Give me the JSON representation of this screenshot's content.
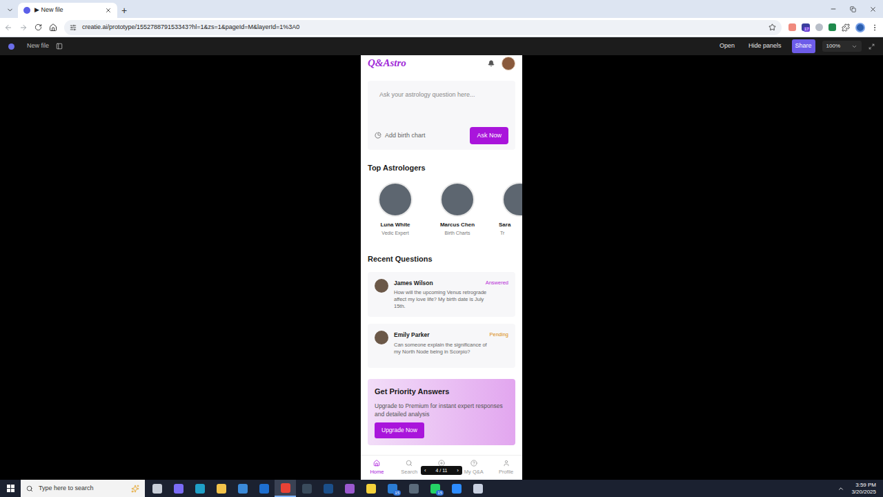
{
  "browser": {
    "tabs": [
      {
        "label": "▶ New file",
        "selected": true
      }
    ],
    "new_tab": "+",
    "url": "creatie.ai/prototype/155278879153343?hl=1&zs=1&pageId=M&layerId=1%3A0",
    "extension_badge": "17"
  },
  "toolbar": {
    "file_name": "New file",
    "buttons": [
      {
        "label": "Open",
        "kind": "plain"
      },
      {
        "label": "Hide panels",
        "kind": "plain"
      },
      {
        "label": "Share",
        "kind": "primary"
      }
    ],
    "zoom": "100%"
  },
  "app": {
    "logo": "Q&Astro",
    "question_placeholder": "Ask your astrology question here...",
    "birth_chart": "Add birth chart",
    "ask_button": "Ask Now",
    "astrologers_title": "Top Astrologers",
    "astrologers": [
      {
        "name": "Luna White",
        "specialty": "Vedic Expert",
        "clipped": false
      },
      {
        "name": "Marcus Chen",
        "specialty": "Birth Charts",
        "clipped": false
      },
      {
        "name": "Sara",
        "specialty": "Tr",
        "clipped": true
      }
    ],
    "questions_title": "Recent Questions",
    "questions": [
      {
        "name": "James Wilson",
        "text": "How will the upcoming Venus retrograde affect my love life? My birth date is July 15th.",
        "status": "Answered",
        "color": "#b62ad6"
      },
      {
        "name": "Emily Parker",
        "text": "Can someone explain the significance of my North Node being in Scorpio?",
        "status": "Pending",
        "color": "#d98b0b"
      }
    ],
    "promo": {
      "title": "Get Priority Answers",
      "text": "Upgrade to Premium for instant expert responses and detailed analysis",
      "button": "Upgrade Now"
    },
    "nav": [
      {
        "label": "Home",
        "kind": "tab",
        "selected": true
      },
      {
        "label": "Search",
        "kind": "tab",
        "selected": false
      },
      {
        "kind": "center",
        "selected": false
      },
      {
        "label": "My Q&A",
        "kind": "tab",
        "selected": false
      },
      {
        "label": "Profile",
        "kind": "tab",
        "selected": false
      }
    ]
  },
  "pager": {
    "prev": "‹",
    "label": "4 / 11",
    "next": "›"
  },
  "taskbar": {
    "search_placeholder": "Type here to search",
    "apps": [
      {
        "color": "#c8ced8",
        "selected": false
      },
      {
        "color": "#7b6cf6",
        "selected": false
      },
      {
        "color": "#1fa0c8",
        "selected": false
      },
      {
        "color": "#f3c34a",
        "selected": false
      },
      {
        "color": "#3b8ad9",
        "selected": false
      },
      {
        "color": "#1e6fd0",
        "selected": false
      },
      {
        "color": "#e94235",
        "selected": true
      },
      {
        "color": "#3a4b5c",
        "selected": false
      },
      {
        "color": "#1b4f8a",
        "selected": false
      },
      {
        "color": "#9b59d0",
        "selected": false
      },
      {
        "color": "#f5d23b",
        "selected": false
      },
      {
        "color": "#2b7cd3",
        "selected": false,
        "badge": "15"
      },
      {
        "color": "#5b6b7b",
        "selected": false
      },
      {
        "color": "#25d366",
        "selected": false,
        "badge": "15"
      },
      {
        "color": "#2d8cff",
        "selected": false
      },
      {
        "color": "#c8d0e0",
        "selected": false
      }
    ],
    "time": "3:59 PM",
    "date": "3/20/2025"
  }
}
